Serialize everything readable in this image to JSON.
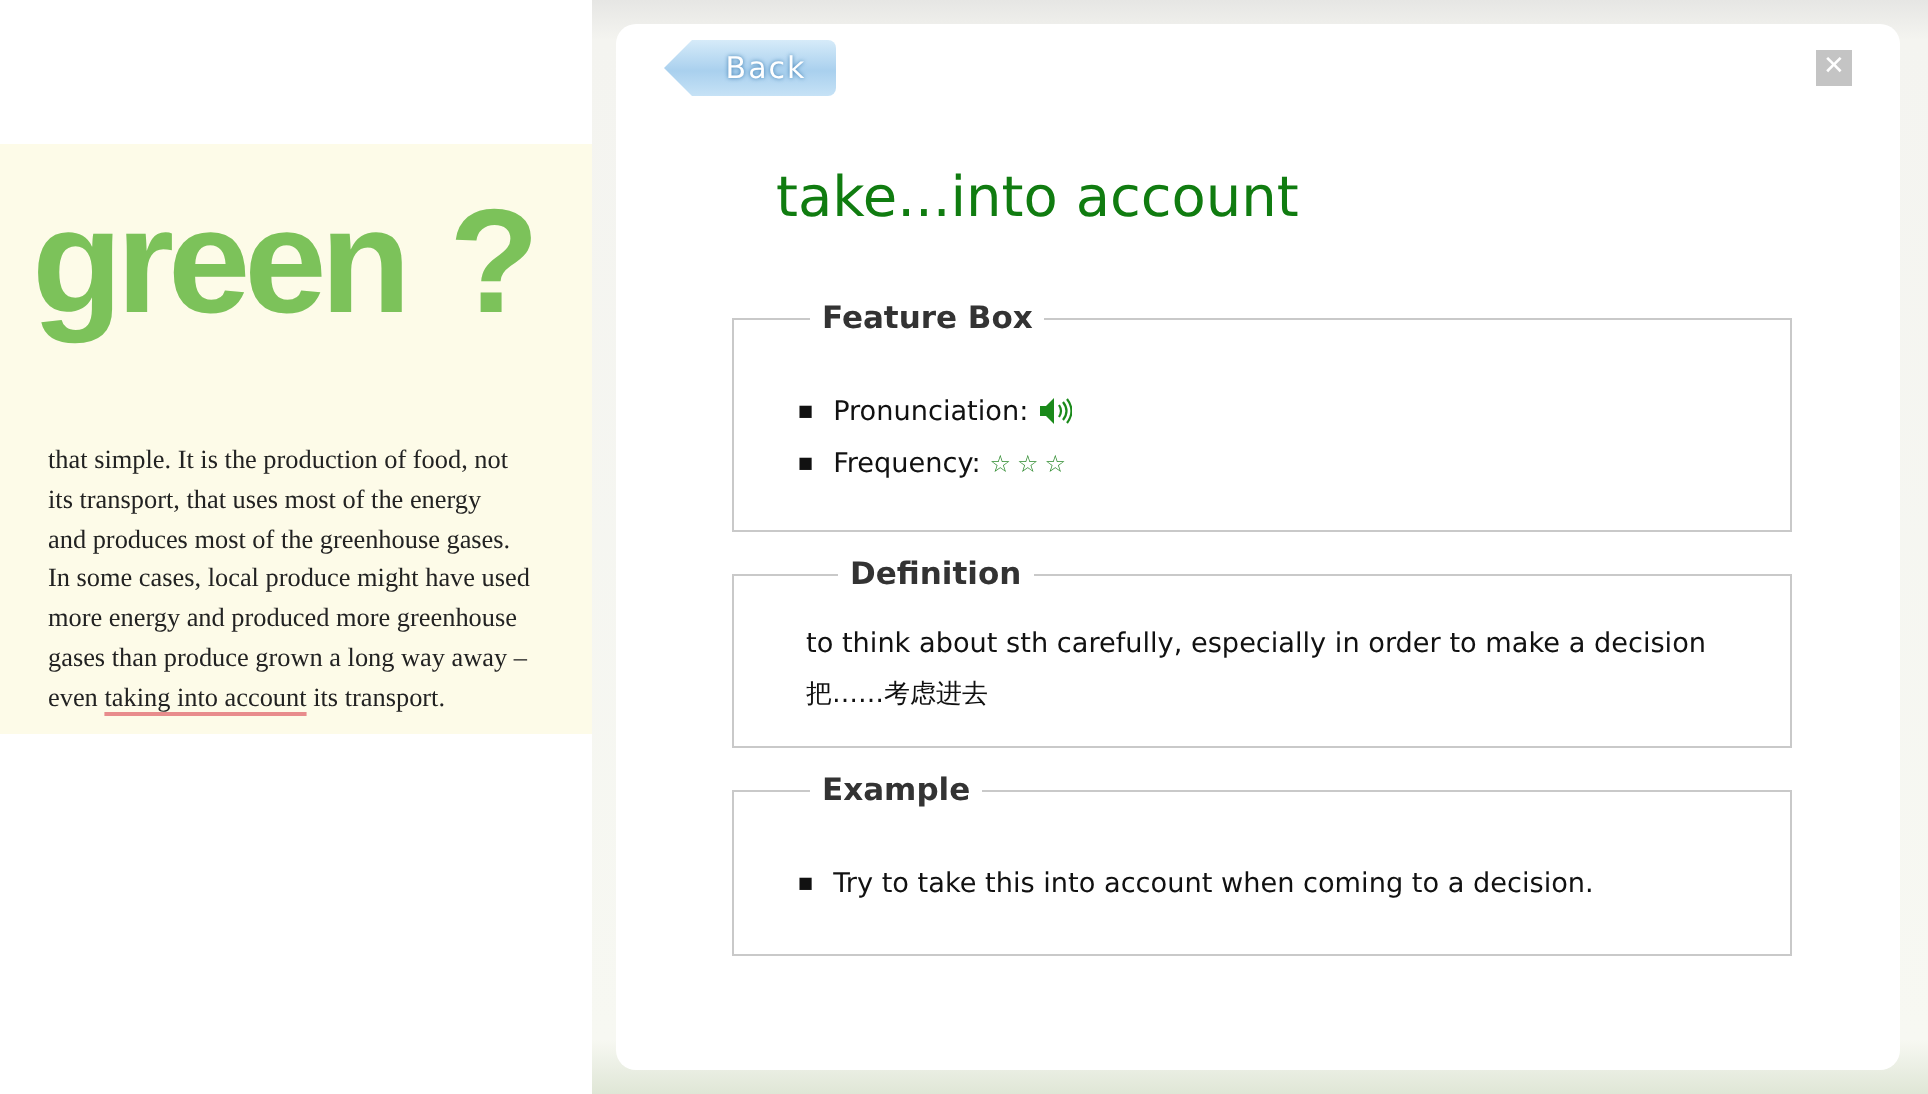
{
  "book_page": {
    "heading": "green",
    "heading_mark": "?",
    "lines": [
      "that simple. It is the production of food, not",
      "its transport, that uses most of the energy",
      "and produces most of the greenhouse gases.",
      "In some cases, local produce might have used",
      "more energy and produced more greenhouse",
      "gases than produce grown a long way away –"
    ],
    "last_line": {
      "before": "even ",
      "highlight": "taking into account",
      "after": " its transport."
    }
  },
  "dialog": {
    "back_button": "Back",
    "close_button": "✕",
    "term": "take...into account",
    "feature_box": {
      "legend": "Feature Box",
      "bullets": [
        "■",
        "■"
      ],
      "pronunciation_label": "Pronunciation:",
      "frequency_label": "Frequency:",
      "stars": 0
    },
    "definition": {
      "legend": "Definition",
      "english": "to think about sth carefully, especially in order to make a decision",
      "chinese": "把……考虑进去"
    },
    "example": {
      "legend": "Example",
      "sentences": [
        {
          "bullet": "■",
          "text": "Try to take this into account when coming to a decision."
        }
      ]
    }
  }
}
